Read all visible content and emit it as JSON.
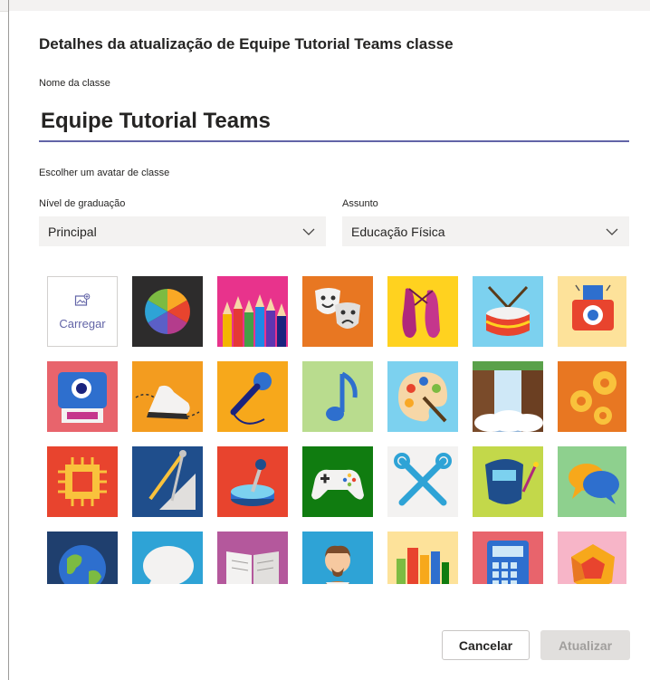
{
  "dialog": {
    "title": "Detalhes da atualização de Equipe Tutorial Teams classe",
    "name_label": "Nome da classe",
    "name_value": "Equipe Tutorial Teams",
    "avatar_label": "Escolher um avatar de classe",
    "grade_label": "Nível de graduação",
    "grade_value": "Principal",
    "subject_label": "Assunto",
    "subject_value": "Educação Física",
    "upload_label": "Carregar",
    "cancel_label": "Cancelar",
    "update_label": "Atualizar"
  },
  "avatars": [
    "upload-tile",
    "color-wheel",
    "colored-pencils",
    "theater-masks",
    "ballet-shoes",
    "drum",
    "photo-camera",
    "polaroid-camera",
    "sneaker",
    "microphone",
    "music-note",
    "paint-palette",
    "waterfall",
    "gears",
    "microchip",
    "drafting-compass",
    "joystick",
    "game-controller",
    "wrench-tools",
    "welding-mask",
    "speech-bubbles",
    "globe",
    "speech-bubble",
    "open-book",
    "shakespeare",
    "books",
    "calculator",
    "dodecahedron"
  ],
  "colors": {
    "accent": "#6264a7",
    "input_underline": "#6264a7",
    "select_bg": "#f3f2f1",
    "disabled_button_bg": "#e1dfdd"
  }
}
